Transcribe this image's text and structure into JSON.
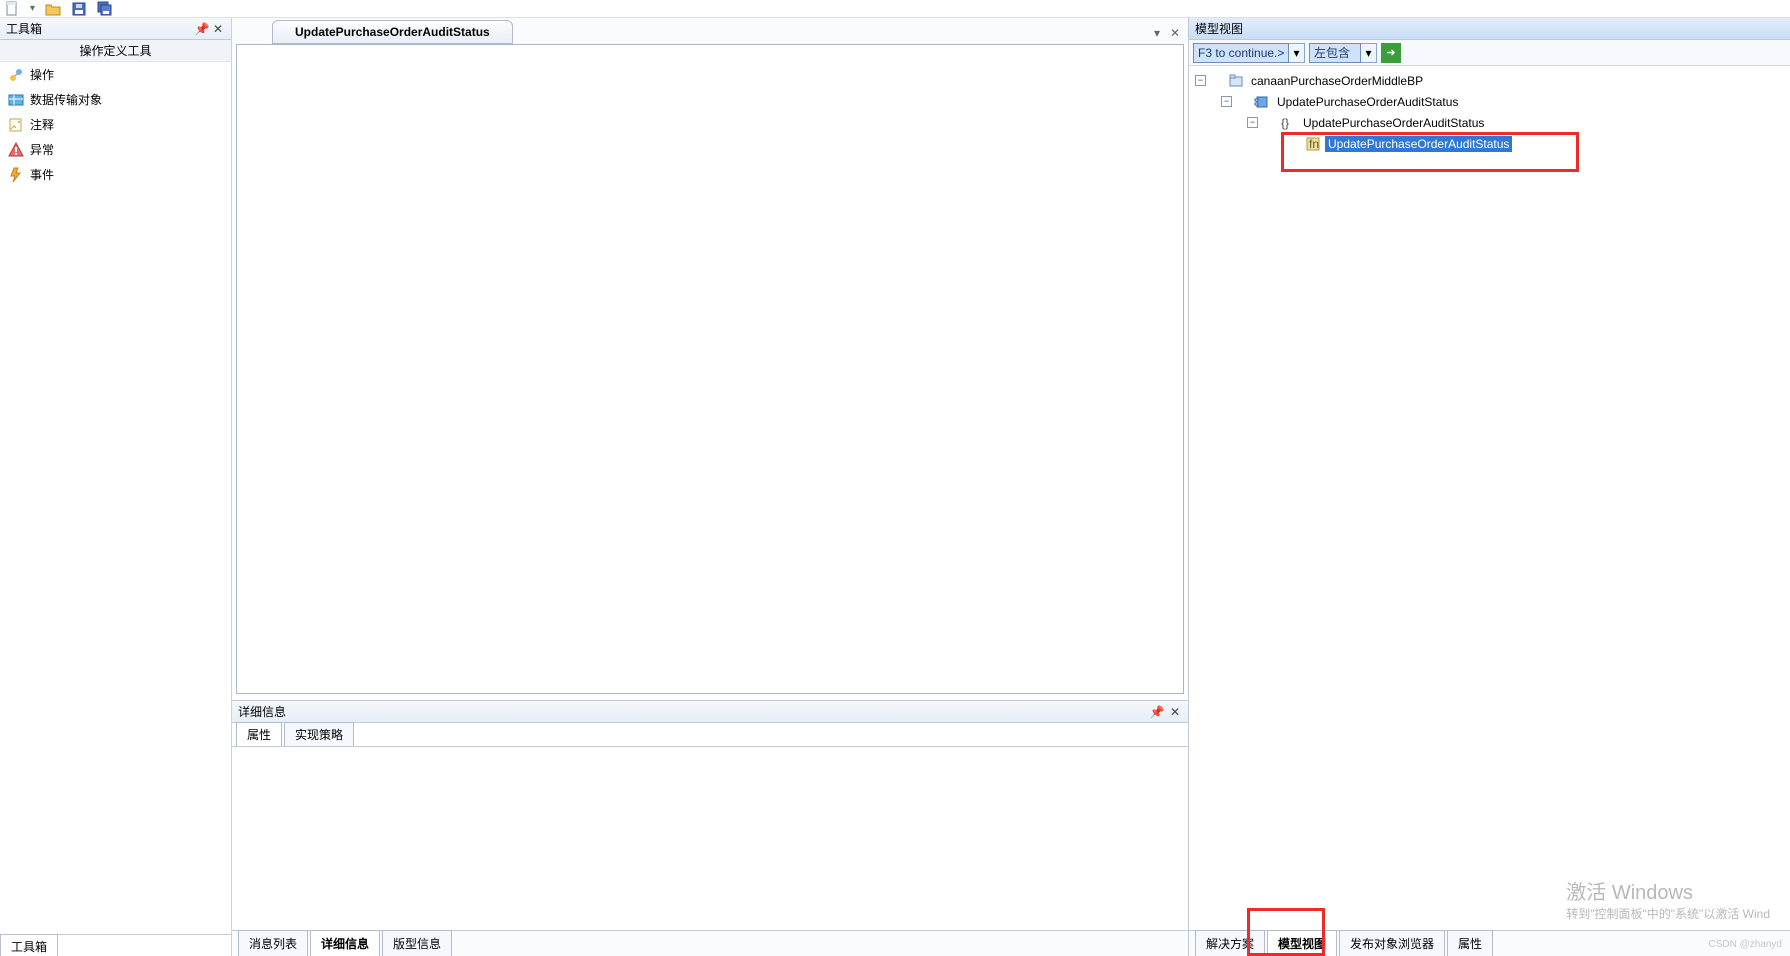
{
  "topbar_icons": [
    "new-file-icon",
    "open-folder-icon",
    "save-icon",
    "save-all-icon"
  ],
  "toolbox": {
    "title": "工具箱",
    "section": "操作定义工具",
    "items": [
      {
        "icon": "action-icon",
        "label": "操作"
      },
      {
        "icon": "dto-icon",
        "label": "数据传输对象"
      },
      {
        "icon": "note-icon",
        "label": "注释"
      },
      {
        "icon": "exception-icon",
        "label": "异常"
      },
      {
        "icon": "event-icon",
        "label": "事件"
      }
    ],
    "tab": "工具箱"
  },
  "document": {
    "tab_title": "UpdatePurchaseOrderAuditStatus"
  },
  "details": {
    "title": "详细信息",
    "subtabs": [
      "属性",
      "实现策略"
    ]
  },
  "left_bottom_tabs": [
    "消息列表",
    "详细信息",
    "版型信息"
  ],
  "modelview": {
    "title": "模型视图",
    "combo1": "F3 to continue.>",
    "combo2": "左包含",
    "tree": {
      "n0": "canaanPurchaseOrderMiddleBP",
      "n1": "UpdatePurchaseOrderAuditStatus",
      "n2": "UpdatePurchaseOrderAuditStatus",
      "n3": "UpdatePurchaseOrderAuditStatus"
    },
    "bottom_tabs": [
      "解决方案",
      "模型视图",
      "发布对象浏览器",
      "属性"
    ]
  },
  "watermark": {
    "l1": "激活 Windows",
    "l2": "转到\"控制面板\"中的\"系统\"以激活 Wind"
  },
  "csdn": "CSDN @zhanyd"
}
